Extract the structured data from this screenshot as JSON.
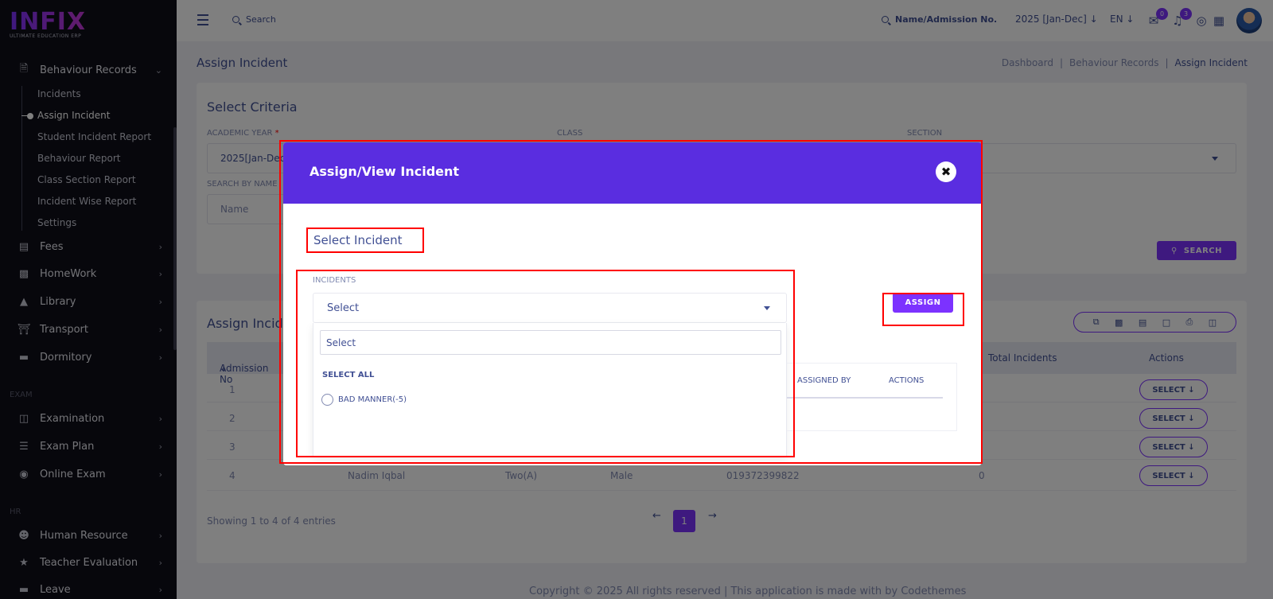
{
  "brand": {
    "logo_text": "INFIX",
    "tagline": "ULTIMATE EDUCATION ERP"
  },
  "sidebar": {
    "behaviour": {
      "label": "Behaviour Records",
      "icon": "documents-icon"
    },
    "sub_items": [
      "Incidents",
      "Assign Incident",
      "Student Incident Report",
      "Behaviour Report",
      "Class Section Report",
      "Incident Wise Report",
      "Settings"
    ],
    "items": [
      {
        "label": "Fees",
        "icon": "money-icon"
      },
      {
        "label": "HomeWork",
        "icon": "book-icon"
      },
      {
        "label": "Library",
        "icon": "library-icon"
      },
      {
        "label": "Transport",
        "icon": "bank-icon"
      },
      {
        "label": "Dormitory",
        "icon": "bed-icon"
      }
    ],
    "exam_section": "EXAM",
    "exam_items": [
      {
        "label": "Examination",
        "icon": "map-icon"
      },
      {
        "label": "Exam Plan",
        "icon": "list-icon"
      },
      {
        "label": "Online Exam",
        "icon": "globe-icon"
      }
    ],
    "hr_section": "HR",
    "hr_items": [
      {
        "label": "Human Resource",
        "icon": "users-icon"
      },
      {
        "label": "Teacher Evaluation",
        "icon": "star-icon"
      },
      {
        "label": "Leave",
        "icon": "bed-icon"
      }
    ]
  },
  "header": {
    "search_placeholder": "Search",
    "student_search": "Name/Admission No.",
    "year": "2025 [Jan-Dec]",
    "lang": "EN",
    "messages_count": "0",
    "notifications_count": "3"
  },
  "page": {
    "title": "Assign Incident",
    "breadcrumb": [
      "Dashboard",
      "Behaviour Records",
      "Assign Incident"
    ],
    "criteria_title": "Select Criteria",
    "academic_year_label": "ACADEMIC YEAR",
    "academic_year_value": "2025[Jan-Dec]",
    "class_label": "CLASS",
    "section_label": "SECTION",
    "search_by_name_label": "SEARCH BY NAME",
    "name_placeholder": "Name",
    "search_button": "SEARCH",
    "list_title": "Assign Incident",
    "columns": [
      "Admission No",
      "Total Incidents",
      "Actions"
    ],
    "rows": [
      {
        "sl": "1",
        "name": "",
        "class": "",
        "gender": "",
        "phone": "",
        "total": ""
      },
      {
        "sl": "2",
        "name": "",
        "class": "",
        "gender": "",
        "phone": "",
        "total": ""
      },
      {
        "sl": "3",
        "name": "",
        "class": "",
        "gender": "",
        "phone": "",
        "total": ""
      },
      {
        "sl": "4",
        "name": "Nadim Iqbal",
        "class": "Two(A)",
        "gender": "Male",
        "phone": "019372399822",
        "total": "0"
      }
    ],
    "row_action": "SELECT",
    "showing": "Showing 1 to 4 of 4 entries",
    "current_page": "1",
    "copyright": "Copyright © 2025 All rights reserved | This application is made with by Codethemes"
  },
  "modal": {
    "title": "Assign/View Incident",
    "subtitle": "Select Incident",
    "incidents_label": "INCIDENTS",
    "select_value": "Select",
    "dropdown_search_placeholder": "Select",
    "select_all": "SELECT ALL",
    "options": [
      "BAD MANNER(-5)"
    ],
    "assign_button": "ASSIGN",
    "assigned_by_col": "ASSIGNED BY",
    "actions_col": "ACTIONS"
  },
  "colors": {
    "accent": "#7c32ff",
    "modal_header": "#5a2de0",
    "annotation": "#ff0000"
  }
}
